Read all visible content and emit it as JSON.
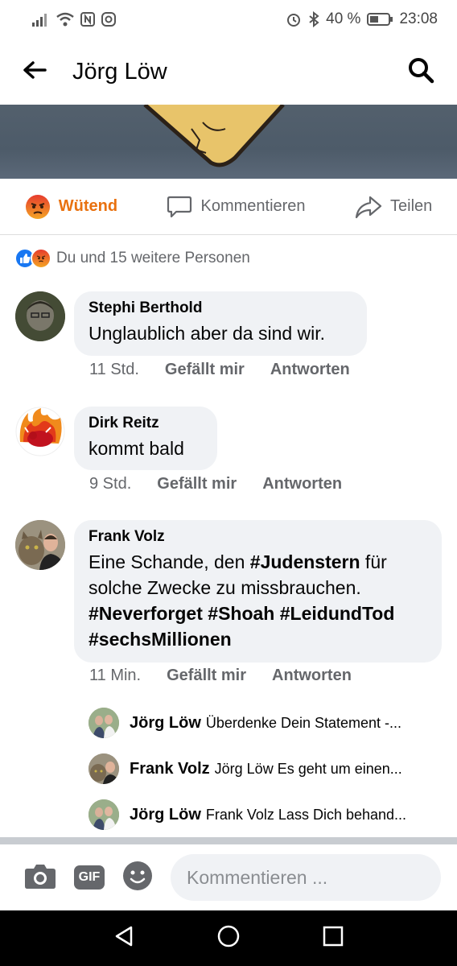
{
  "status": {
    "battery": "40 %",
    "time": "23:08"
  },
  "header": {
    "title": "Jörg Löw"
  },
  "actions": {
    "react_label": "Wütend",
    "comment_label": "Kommentieren",
    "share_label": "Teilen"
  },
  "reactions_summary": "Du und 15 weitere Personen",
  "comments": [
    {
      "author": "Stephi Berthold",
      "text": "Unglaublich aber da sind wir.",
      "time": "11 Std.",
      "like": "Gefällt mir",
      "reply": "Antworten"
    },
    {
      "author": "Dirk Reitz",
      "text": "kommt bald",
      "time": "9 Std.",
      "like": "Gefällt mir",
      "reply": "Antworten"
    },
    {
      "author": "Frank Volz",
      "text_parts": [
        "Eine Schande, den ",
        "#Judenstern",
        " für solche Zwecke zu missbrauchen. ",
        "#Neverforget",
        " ",
        "#Shoah",
        " ",
        "#LeidundTod",
        " ",
        "#sechsMillionen"
      ],
      "time": "11 Min.",
      "like": "Gefällt mir",
      "reply": "Antworten"
    }
  ],
  "replies": [
    {
      "author": "Jörg Löw",
      "text": "Überdenke  Dein Statement -..."
    },
    {
      "author": "Frank Volz",
      "text": "Jörg Löw Es geht um einen..."
    },
    {
      "author": "Jörg Löw",
      "text": "Frank Volz Lass Dich behand..."
    }
  ],
  "composer": {
    "placeholder": "Kommentieren ...",
    "gif_label": "GIF"
  },
  "colors": {
    "angry": "#e9710f",
    "like_blue": "#1877f2",
    "bubble": "#f0f2f5",
    "meta": "#65676b"
  }
}
